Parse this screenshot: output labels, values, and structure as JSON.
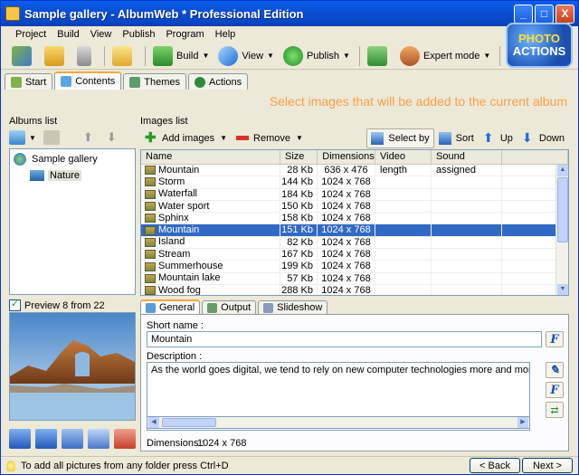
{
  "window": {
    "title": "Sample gallery - AlbumWeb * Professional Edition",
    "min_label": "_",
    "max_label": "□",
    "close_label": "X"
  },
  "menu": [
    "Project",
    "Build",
    "View",
    "Publish",
    "Program",
    "Help"
  ],
  "toolbar": {
    "build_label": "Build",
    "view_label": "View",
    "publish_label": "Publish",
    "expert_label": "Expert mode"
  },
  "logo": {
    "line1": "PHOTO",
    "line2": "ACTIONS"
  },
  "tabs": [
    {
      "label": "Start"
    },
    {
      "label": "Contents",
      "active": true
    },
    {
      "label": "Themes"
    },
    {
      "label": "Actions"
    }
  ],
  "hint": "Select images that will be added to the current album",
  "albums": {
    "heading": "Albums list",
    "root": "Sample gallery",
    "child": "Nature"
  },
  "preview": {
    "label": "Preview 8 from 22"
  },
  "images": {
    "heading": "Images list",
    "add_label": "Add images",
    "remove_label": "Remove",
    "select_label": "Select by",
    "sort_label": "Sort",
    "up_label": "Up",
    "down_label": "Down",
    "columns": [
      "Name",
      "Size",
      "Dimensions",
      "Video length",
      "Sound assigned"
    ],
    "rows": [
      {
        "name": "Mountain",
        "size": "28 Kb",
        "dim": "636 x 476"
      },
      {
        "name": "Storm",
        "size": "144 Kb",
        "dim": "1024 x 768"
      },
      {
        "name": "Waterfall",
        "size": "184 Kb",
        "dim": "1024 x 768"
      },
      {
        "name": "Water sport",
        "size": "150 Kb",
        "dim": "1024 x 768"
      },
      {
        "name": "Sphinx",
        "size": "158 Kb",
        "dim": "1024 x 768"
      },
      {
        "name": "Mountain",
        "size": "151 Kb",
        "dim": "1024 x 768",
        "selected": true
      },
      {
        "name": "Island",
        "size": "82 Kb",
        "dim": "1024 x 768"
      },
      {
        "name": "Stream",
        "size": "167 Kb",
        "dim": "1024 x 768"
      },
      {
        "name": "Summerhouse",
        "size": "199 Kb",
        "dim": "1024 x 768"
      },
      {
        "name": "Mountain lake",
        "size": "57 Kb",
        "dim": "1024 x 768"
      },
      {
        "name": "Wood fog",
        "size": "288 Kb",
        "dim": "1024 x 768"
      }
    ]
  },
  "details": {
    "tabs": [
      "General",
      "Output",
      "Slideshow"
    ],
    "short_name_label": "Short name :",
    "short_name_value": "Mountain",
    "description_label": "Description :",
    "description_value": "As the world goes digital, we tend to rely on new computer technologies more and more each day. We switch f",
    "dimensions_label": "Dimensions :",
    "dimensions_value": "1024 x 768"
  },
  "status": {
    "text": "To add all pictures from any folder press Ctrl+D",
    "back_label": "< Back",
    "next_label": "Next >"
  }
}
